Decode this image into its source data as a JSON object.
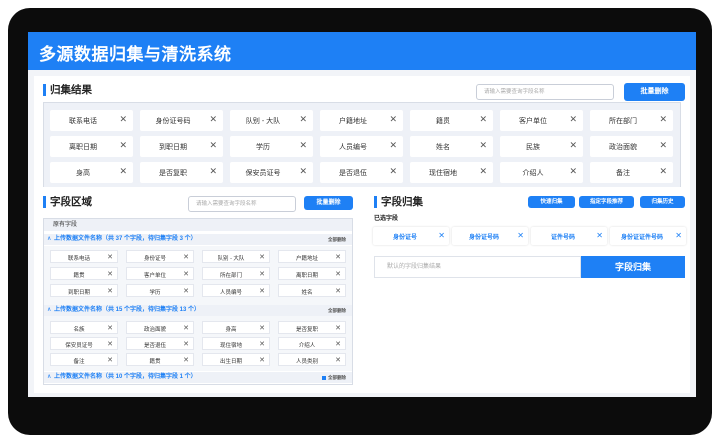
{
  "app": {
    "title": "多源数据归集与清洗系统"
  },
  "result": {
    "title": "归集结果",
    "search_placeholder": "请输入需要查询字段名称",
    "batch_delete": "批量删除",
    "tags": [
      "联系电话",
      "身份证号码",
      "队别 - 大队",
      "户籍地址",
      "籍贯",
      "客户单位",
      "所在部门",
      "离职日期",
      "到职日期",
      "学历",
      "人员编号",
      "姓名",
      "民族",
      "政治面貌",
      "身高",
      "是否复职",
      "保安员证号",
      "是否退伍",
      "现住宿地",
      "介绍人",
      "备注"
    ]
  },
  "area": {
    "title": "字段区域",
    "search_placeholder": "请输入需要查询字段名称",
    "batch_delete": "批量删除",
    "header": "原有字段",
    "groups": [
      {
        "title": "上传数据文件名称（共 37 个字段，待归集字段 3 个）",
        "delete": "全部删除",
        "chips": [
          "联系电话",
          "身份证号",
          "队别 - 大队",
          "户籍地址",
          "籍贯",
          "客户单位",
          "所在部门",
          "离职日期",
          "到职日期",
          "学历",
          "人员编号",
          "姓名"
        ]
      },
      {
        "title": "上传数据文件名称（共 15 个字段，待归集字段 13 个）",
        "delete": "全部删除",
        "chips": [
          "名族",
          "政治面貌",
          "身高",
          "是否复职",
          "保安员证号",
          "是否退伍",
          "现住宿地",
          "介绍人",
          "备注",
          "籍贯",
          "出生日期",
          "人员类别"
        ]
      },
      {
        "title": "上传数据文件名称（共 10 个字段，待归集字段 1 个）",
        "delete": "全部删除",
        "chips": []
      }
    ]
  },
  "merge": {
    "title": "字段归集",
    "buttons": [
      "快速归集",
      "指定字段推荐",
      "归集历史"
    ],
    "selected_label": "已选字段",
    "selected": [
      "身份证号",
      "身份证号码",
      "证件号码",
      "身份证证件号码"
    ],
    "input_placeholder": "默认的字段归集结果",
    "merge_button": "字段归集"
  },
  "colors": {
    "primary": "#1e80f5"
  }
}
